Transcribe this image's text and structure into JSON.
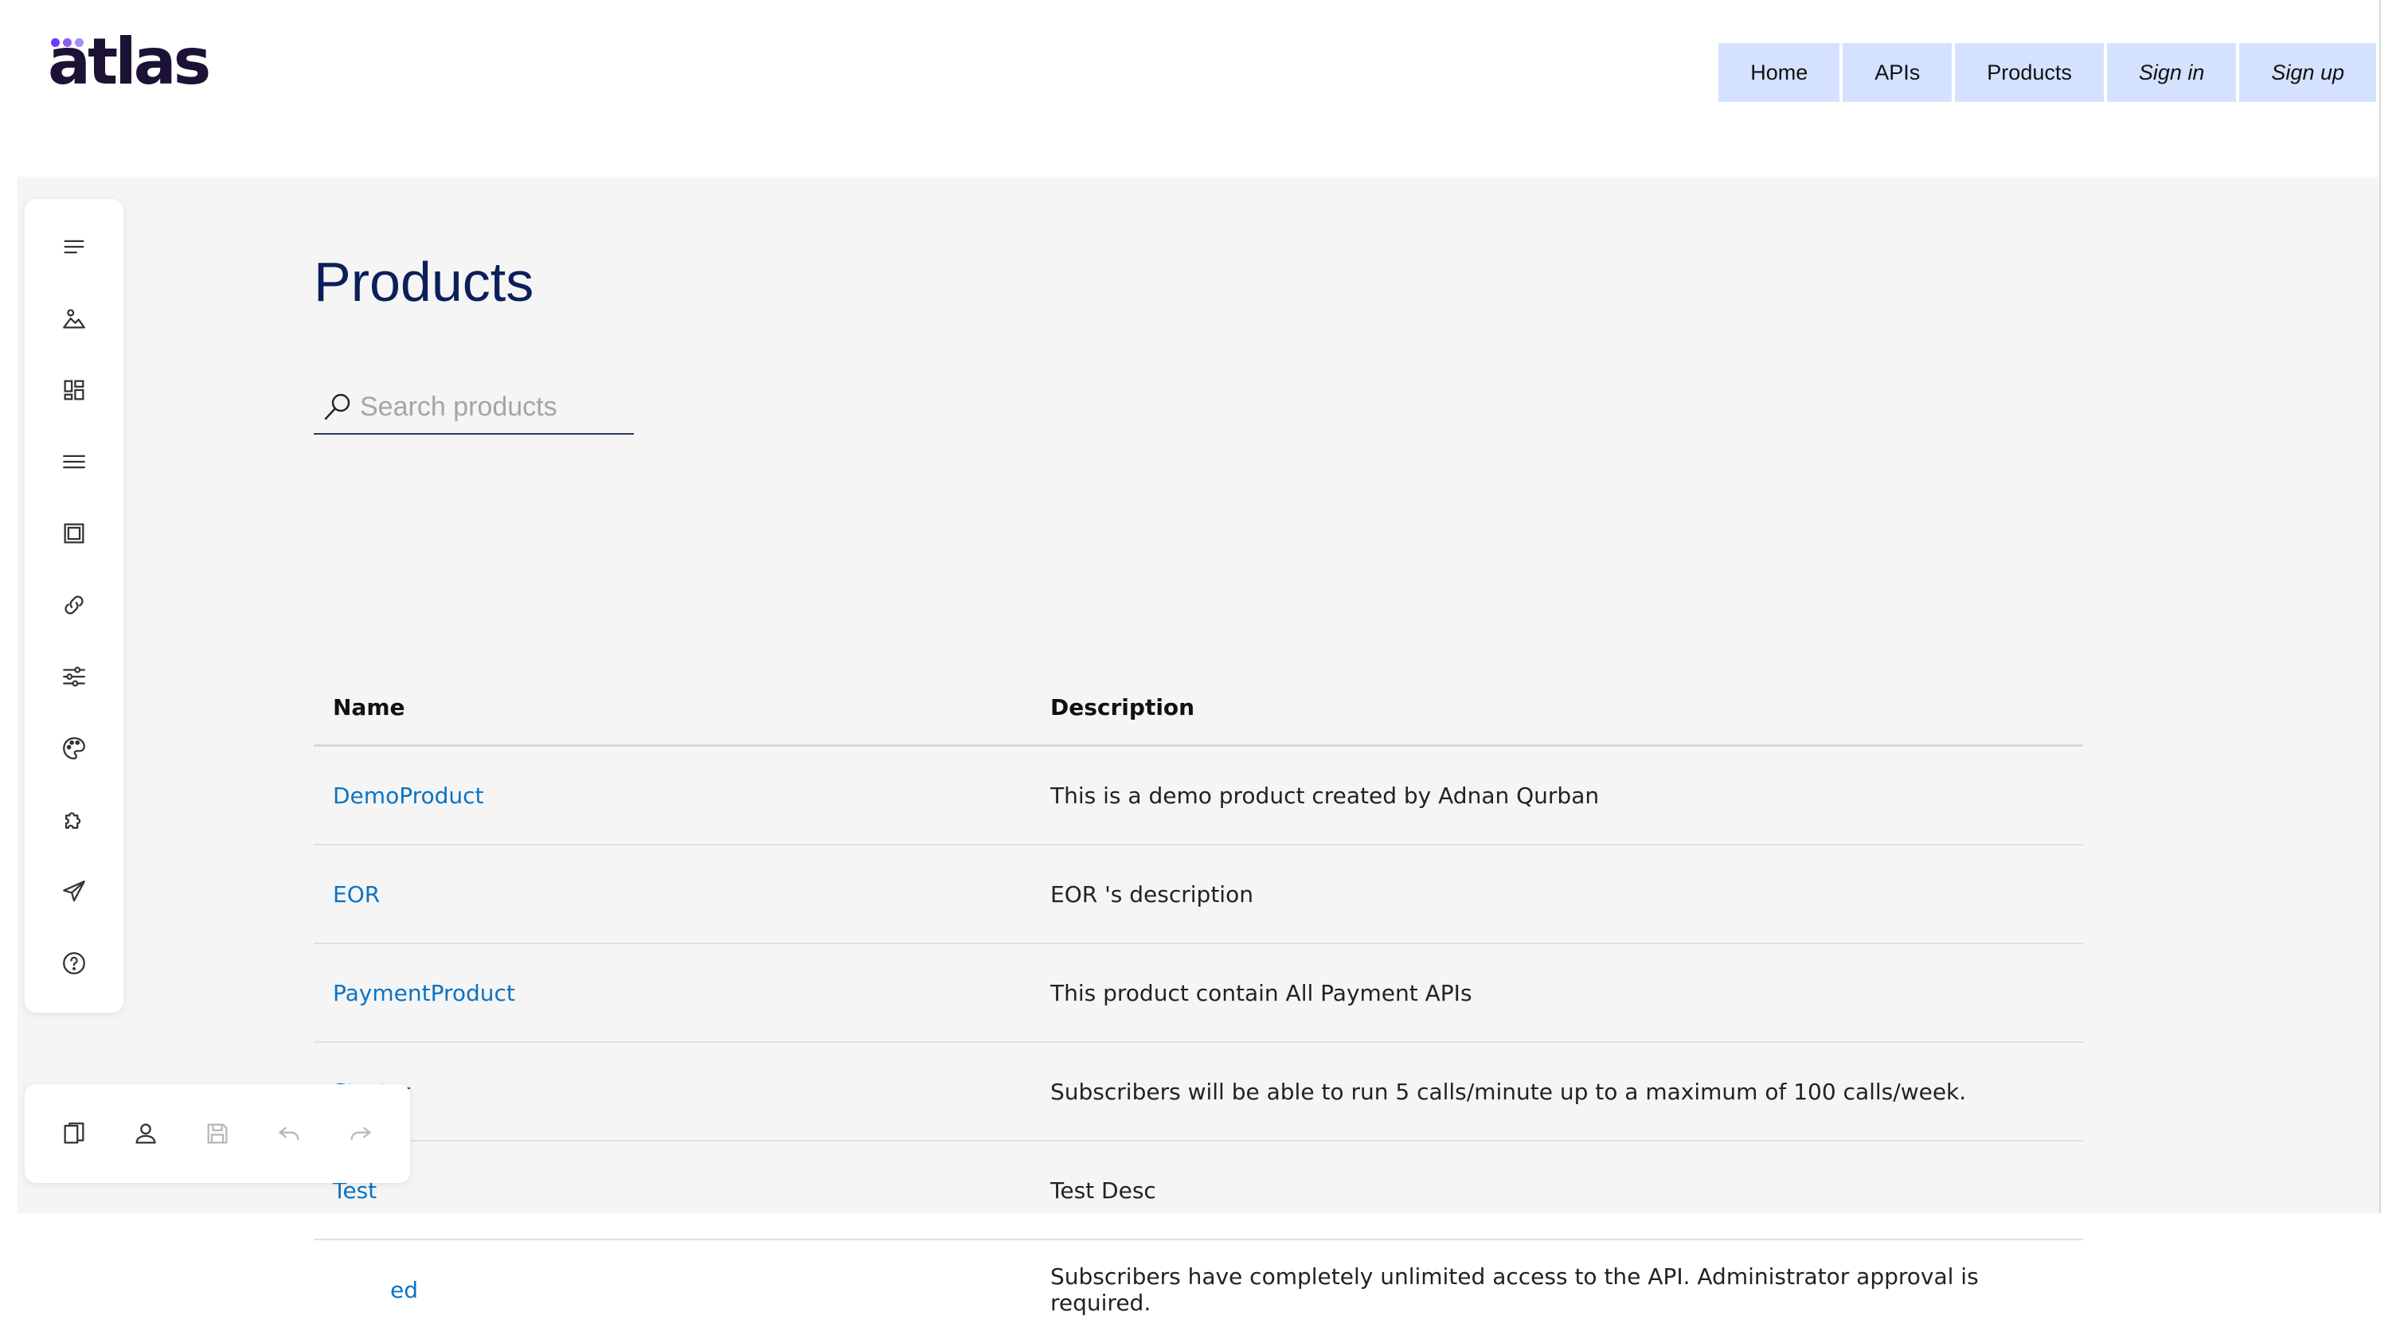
{
  "brand": {
    "logo_text": "atlas"
  },
  "nav": {
    "home": "Home",
    "apis": "APIs",
    "products": "Products",
    "sign_in": "Sign in",
    "sign_up": "Sign up"
  },
  "page": {
    "title": "Products"
  },
  "search": {
    "placeholder": "Search products",
    "value": ""
  },
  "table": {
    "headers": {
      "name": "Name",
      "description": "Description"
    },
    "rows": [
      {
        "name": "DemoProduct",
        "description": "This is a demo product created by Adnan Qurban"
      },
      {
        "name": "EOR",
        "description": "EOR 's description"
      },
      {
        "name": "PaymentProduct",
        "description": "This product contain All Payment APIs"
      },
      {
        "name": "Starter",
        "description": "Subscribers will be able to run 5 calls/minute up to a maximum of 100 calls/week."
      },
      {
        "name": "Test",
        "description": "Test Desc"
      },
      {
        "name": "ed",
        "description": "Subscribers have completely unlimited access to the API. Administrator approval is required."
      }
    ]
  },
  "toolbar_icons": [
    "text-lines-icon",
    "image-icon",
    "dashboard-icon",
    "menu-icon",
    "frame-icon",
    "link-icon",
    "sliders-icon",
    "palette-icon",
    "puzzle-icon",
    "send-icon",
    "help-icon"
  ],
  "bottom_icons": [
    "pages-icon",
    "user-icon",
    "save-icon",
    "undo-icon",
    "redo-icon"
  ],
  "colors": {
    "accent_link": "#0b73c4",
    "title": "#0c1f5c",
    "nav_bg": "#d5e2ff",
    "content_bg": "#f5f5f5"
  }
}
